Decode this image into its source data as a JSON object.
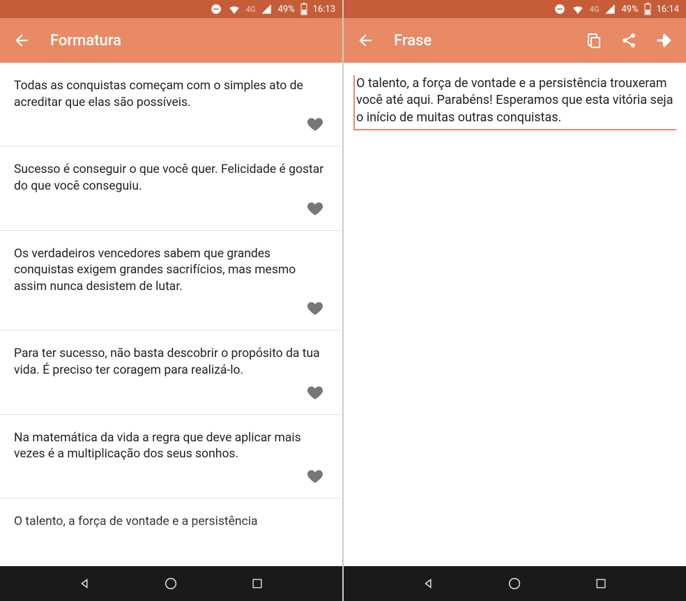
{
  "left": {
    "status": {
      "network": "4G",
      "battery": "49%",
      "time": "16:13"
    },
    "title": "Formatura",
    "items": [
      {
        "text": "Todas as conquistas começam com o simples ato de acreditar que elas são possíveis."
      },
      {
        "text": "Sucesso é conseguir o que você quer. Felicidade é gostar do que você conseguiu."
      },
      {
        "text": "Os verdadeiros vencedores sabem que grandes conquistas exigem grandes sacrifícios, mas mesmo assim nunca desistem de lutar."
      },
      {
        "text": "Para ter sucesso, não basta descobrir o propósito da tua vida. É preciso ter coragem para realizá-lo."
      },
      {
        "text": "Na matemática da vida a regra que deve aplicar mais vezes é a multiplicação dos seus sonhos."
      },
      {
        "text": "O talento, a força de vontade e a persistência"
      }
    ]
  },
  "right": {
    "status": {
      "network": "4G",
      "battery": "49%",
      "time": "16:14"
    },
    "title": "Frase",
    "detail_text": "O talento, a força de vontade e a persistência trouxeram você até aqui. Parabéns! Esperamos que esta vitória seja o início de muitas outras conquistas."
  }
}
